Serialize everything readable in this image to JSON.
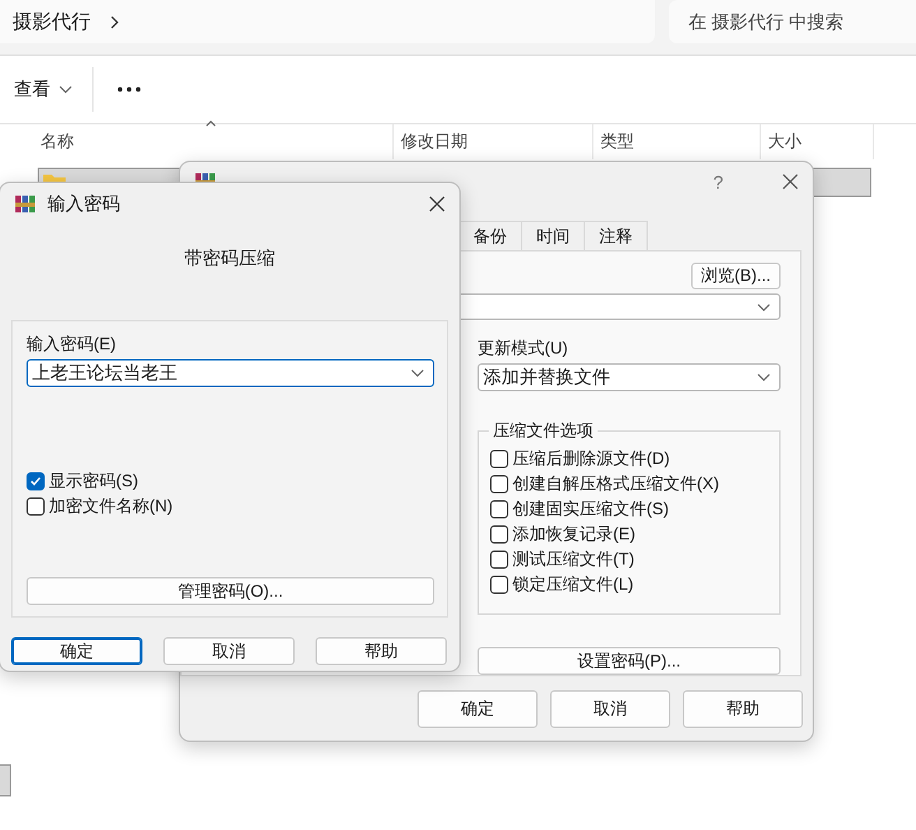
{
  "explorer": {
    "breadcrumb": "摄影代行",
    "search": {
      "placeholder": "在 摄影代行 中搜索"
    },
    "toolbar": {
      "view": "查看"
    },
    "columns": [
      "名称",
      "修改日期",
      "类型",
      "大小"
    ],
    "rows": [
      {
        "selected": true
      }
    ]
  },
  "back_dialog": {
    "help": "?",
    "tabs": [
      {
        "label": "备份",
        "selected": false
      },
      {
        "label": "时间",
        "selected": false
      },
      {
        "label": "注释",
        "selected": false
      }
    ],
    "browse_button": "浏览(B)...",
    "update_mode": {
      "label": "更新模式(U)",
      "value": "添加并替换文件"
    },
    "options_group": {
      "title": "压缩文件选项",
      "options": [
        {
          "label": "压缩后删除源文件(D)",
          "checked": false
        },
        {
          "label": "创建自解压格式压缩文件(X)",
          "checked": false
        },
        {
          "label": "创建固实压缩文件(S)",
          "checked": false
        },
        {
          "label": "添加恢复记录(E)",
          "checked": false
        },
        {
          "label": "测试压缩文件(T)",
          "checked": false
        },
        {
          "label": "锁定压缩文件(L)",
          "checked": false
        }
      ]
    },
    "set_password_button": "设置密码(P)...",
    "buttons": [
      {
        "label": "确定",
        "default": false
      },
      {
        "label": "取消",
        "default": false
      },
      {
        "label": "帮助",
        "default": false
      }
    ]
  },
  "front_dialog": {
    "title": "输入密码",
    "heading": "带密码压缩",
    "password": {
      "label": "输入密码(E)",
      "value": "上老王论坛当老王"
    },
    "options": [
      {
        "label": "显示密码(S)",
        "checked": true
      },
      {
        "label": "加密文件名称(N)",
        "checked": false
      }
    ],
    "manage_button": "管理密码(O)...",
    "buttons": [
      {
        "label": "确定",
        "default": true
      },
      {
        "label": "取消",
        "default": false
      },
      {
        "label": "帮助",
        "default": false
      }
    ]
  }
}
